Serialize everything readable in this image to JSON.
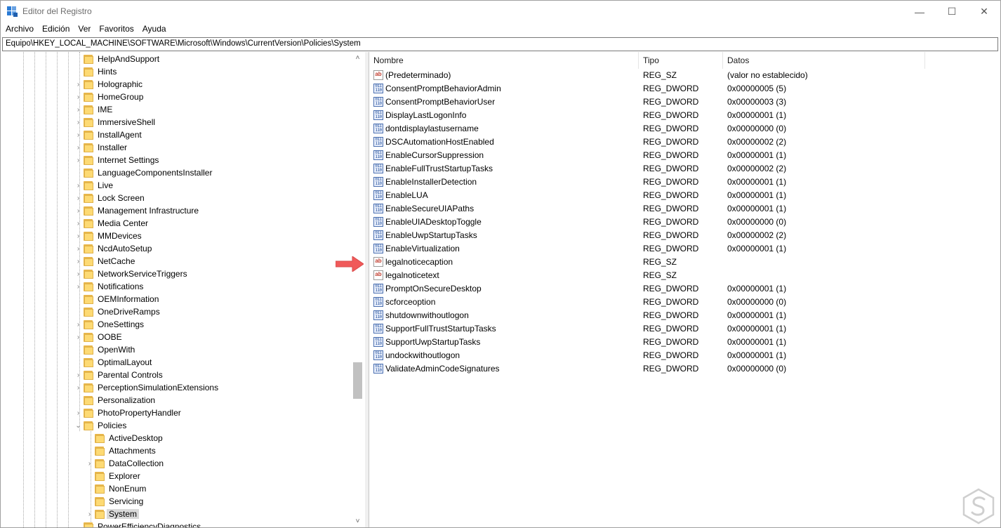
{
  "window": {
    "title": "Editor del Registro",
    "controls": {
      "minimize": "—",
      "maximize": "☐",
      "close": "✕"
    }
  },
  "menu": [
    "Archivo",
    "Edición",
    "Ver",
    "Favoritos",
    "Ayuda"
  ],
  "address": "Equipo\\HKEY_LOCAL_MACHINE\\SOFTWARE\\Microsoft\\Windows\\CurrentVersion\\Policies\\System",
  "tree": {
    "items": [
      {
        "label": "HelpAndSupport",
        "level": 0,
        "expandable": false
      },
      {
        "label": "Hints",
        "level": 0,
        "expandable": false
      },
      {
        "label": "Holographic",
        "level": 0,
        "expandable": true
      },
      {
        "label": "HomeGroup",
        "level": 0,
        "expandable": true
      },
      {
        "label": "IME",
        "level": 0,
        "expandable": true
      },
      {
        "label": "ImmersiveShell",
        "level": 0,
        "expandable": true
      },
      {
        "label": "InstallAgent",
        "level": 0,
        "expandable": true
      },
      {
        "label": "Installer",
        "level": 0,
        "expandable": true
      },
      {
        "label": "Internet Settings",
        "level": 0,
        "expandable": true
      },
      {
        "label": "LanguageComponentsInstaller",
        "level": 0,
        "expandable": false
      },
      {
        "label": "Live",
        "level": 0,
        "expandable": true
      },
      {
        "label": "Lock Screen",
        "level": 0,
        "expandable": true
      },
      {
        "label": "Management Infrastructure",
        "level": 0,
        "expandable": true
      },
      {
        "label": "Media Center",
        "level": 0,
        "expandable": true
      },
      {
        "label": "MMDevices",
        "level": 0,
        "expandable": true
      },
      {
        "label": "NcdAutoSetup",
        "level": 0,
        "expandable": true
      },
      {
        "label": "NetCache",
        "level": 0,
        "expandable": true
      },
      {
        "label": "NetworkServiceTriggers",
        "level": 0,
        "expandable": true
      },
      {
        "label": "Notifications",
        "level": 0,
        "expandable": true
      },
      {
        "label": "OEMInformation",
        "level": 0,
        "expandable": false
      },
      {
        "label": "OneDriveRamps",
        "level": 0,
        "expandable": false
      },
      {
        "label": "OneSettings",
        "level": 0,
        "expandable": true
      },
      {
        "label": "OOBE",
        "level": 0,
        "expandable": true
      },
      {
        "label": "OpenWith",
        "level": 0,
        "expandable": false
      },
      {
        "label": "OptimalLayout",
        "level": 0,
        "expandable": false
      },
      {
        "label": "Parental Controls",
        "level": 0,
        "expandable": true
      },
      {
        "label": "PerceptionSimulationExtensions",
        "level": 0,
        "expandable": true
      },
      {
        "label": "Personalization",
        "level": 0,
        "expandable": false
      },
      {
        "label": "PhotoPropertyHandler",
        "level": 0,
        "expandable": true
      },
      {
        "label": "Policies",
        "level": 0,
        "expandable": true,
        "expanded": true
      },
      {
        "label": "ActiveDesktop",
        "level": 1,
        "expandable": false
      },
      {
        "label": "Attachments",
        "level": 1,
        "expandable": false
      },
      {
        "label": "DataCollection",
        "level": 1,
        "expandable": true
      },
      {
        "label": "Explorer",
        "level": 1,
        "expandable": false
      },
      {
        "label": "NonEnum",
        "level": 1,
        "expandable": false
      },
      {
        "label": "Servicing",
        "level": 1,
        "expandable": false
      },
      {
        "label": "System",
        "level": 1,
        "expandable": true,
        "selected": true
      },
      {
        "label": "PowerEfficiencyDiagnostics",
        "level": 0,
        "expandable": false
      }
    ]
  },
  "list": {
    "columns": {
      "name": "Nombre",
      "type": "Tipo",
      "data": "Datos"
    },
    "rows": [
      {
        "name": "(Predeterminado)",
        "type": "REG_SZ",
        "data": "(valor no establecido)",
        "icon": "string-value-icon"
      },
      {
        "name": "ConsentPromptBehaviorAdmin",
        "type": "REG_DWORD",
        "data": "0x00000005 (5)",
        "icon": "dword-value-icon"
      },
      {
        "name": "ConsentPromptBehaviorUser",
        "type": "REG_DWORD",
        "data": "0x00000003 (3)",
        "icon": "dword-value-icon"
      },
      {
        "name": "DisplayLastLogonInfo",
        "type": "REG_DWORD",
        "data": "0x00000001 (1)",
        "icon": "dword-value-icon"
      },
      {
        "name": "dontdisplaylastusername",
        "type": "REG_DWORD",
        "data": "0x00000000 (0)",
        "icon": "dword-value-icon"
      },
      {
        "name": "DSCAutomationHostEnabled",
        "type": "REG_DWORD",
        "data": "0x00000002 (2)",
        "icon": "dword-value-icon"
      },
      {
        "name": "EnableCursorSuppression",
        "type": "REG_DWORD",
        "data": "0x00000001 (1)",
        "icon": "dword-value-icon"
      },
      {
        "name": "EnableFullTrustStartupTasks",
        "type": "REG_DWORD",
        "data": "0x00000002 (2)",
        "icon": "dword-value-icon"
      },
      {
        "name": "EnableInstallerDetection",
        "type": "REG_DWORD",
        "data": "0x00000001 (1)",
        "icon": "dword-value-icon"
      },
      {
        "name": "EnableLUA",
        "type": "REG_DWORD",
        "data": "0x00000001 (1)",
        "icon": "dword-value-icon"
      },
      {
        "name": "EnableSecureUIAPaths",
        "type": "REG_DWORD",
        "data": "0x00000001 (1)",
        "icon": "dword-value-icon"
      },
      {
        "name": "EnableUIADesktopToggle",
        "type": "REG_DWORD",
        "data": "0x00000000 (0)",
        "icon": "dword-value-icon"
      },
      {
        "name": "EnableUwpStartupTasks",
        "type": "REG_DWORD",
        "data": "0x00000002 (2)",
        "icon": "dword-value-icon"
      },
      {
        "name": "EnableVirtualization",
        "type": "REG_DWORD",
        "data": "0x00000001 (1)",
        "icon": "dword-value-icon"
      },
      {
        "name": "legalnoticecaption",
        "type": "REG_SZ",
        "data": "",
        "icon": "string-value-icon"
      },
      {
        "name": "legalnoticetext",
        "type": "REG_SZ",
        "data": "",
        "icon": "string-value-icon"
      },
      {
        "name": "PromptOnSecureDesktop",
        "type": "REG_DWORD",
        "data": "0x00000001 (1)",
        "icon": "dword-value-icon"
      },
      {
        "name": "scforceoption",
        "type": "REG_DWORD",
        "data": "0x00000000 (0)",
        "icon": "dword-value-icon"
      },
      {
        "name": "shutdownwithoutlogon",
        "type": "REG_DWORD",
        "data": "0x00000001 (1)",
        "icon": "dword-value-icon"
      },
      {
        "name": "SupportFullTrustStartupTasks",
        "type": "REG_DWORD",
        "data": "0x00000001 (1)",
        "icon": "dword-value-icon"
      },
      {
        "name": "SupportUwpStartupTasks",
        "type": "REG_DWORD",
        "data": "0x00000001 (1)",
        "icon": "dword-value-icon"
      },
      {
        "name": "undockwithoutlogon",
        "type": "REG_DWORD",
        "data": "0x00000001 (1)",
        "icon": "dword-value-icon"
      },
      {
        "name": "ValidateAdminCodeSignatures",
        "type": "REG_DWORD",
        "data": "0x00000000 (0)",
        "icon": "dword-value-icon"
      }
    ]
  },
  "icons": {
    "string_glyph": "ab",
    "dword_glyph": "011\n110",
    "expand_glyph": "›",
    "expanded_glyph": "⌄",
    "scroll_up": "˄",
    "scroll_down": "˅"
  },
  "colors": {
    "annotation_arrow": "#f05a5a",
    "folder": "#fdda74",
    "selection": "#d9d9d9"
  }
}
